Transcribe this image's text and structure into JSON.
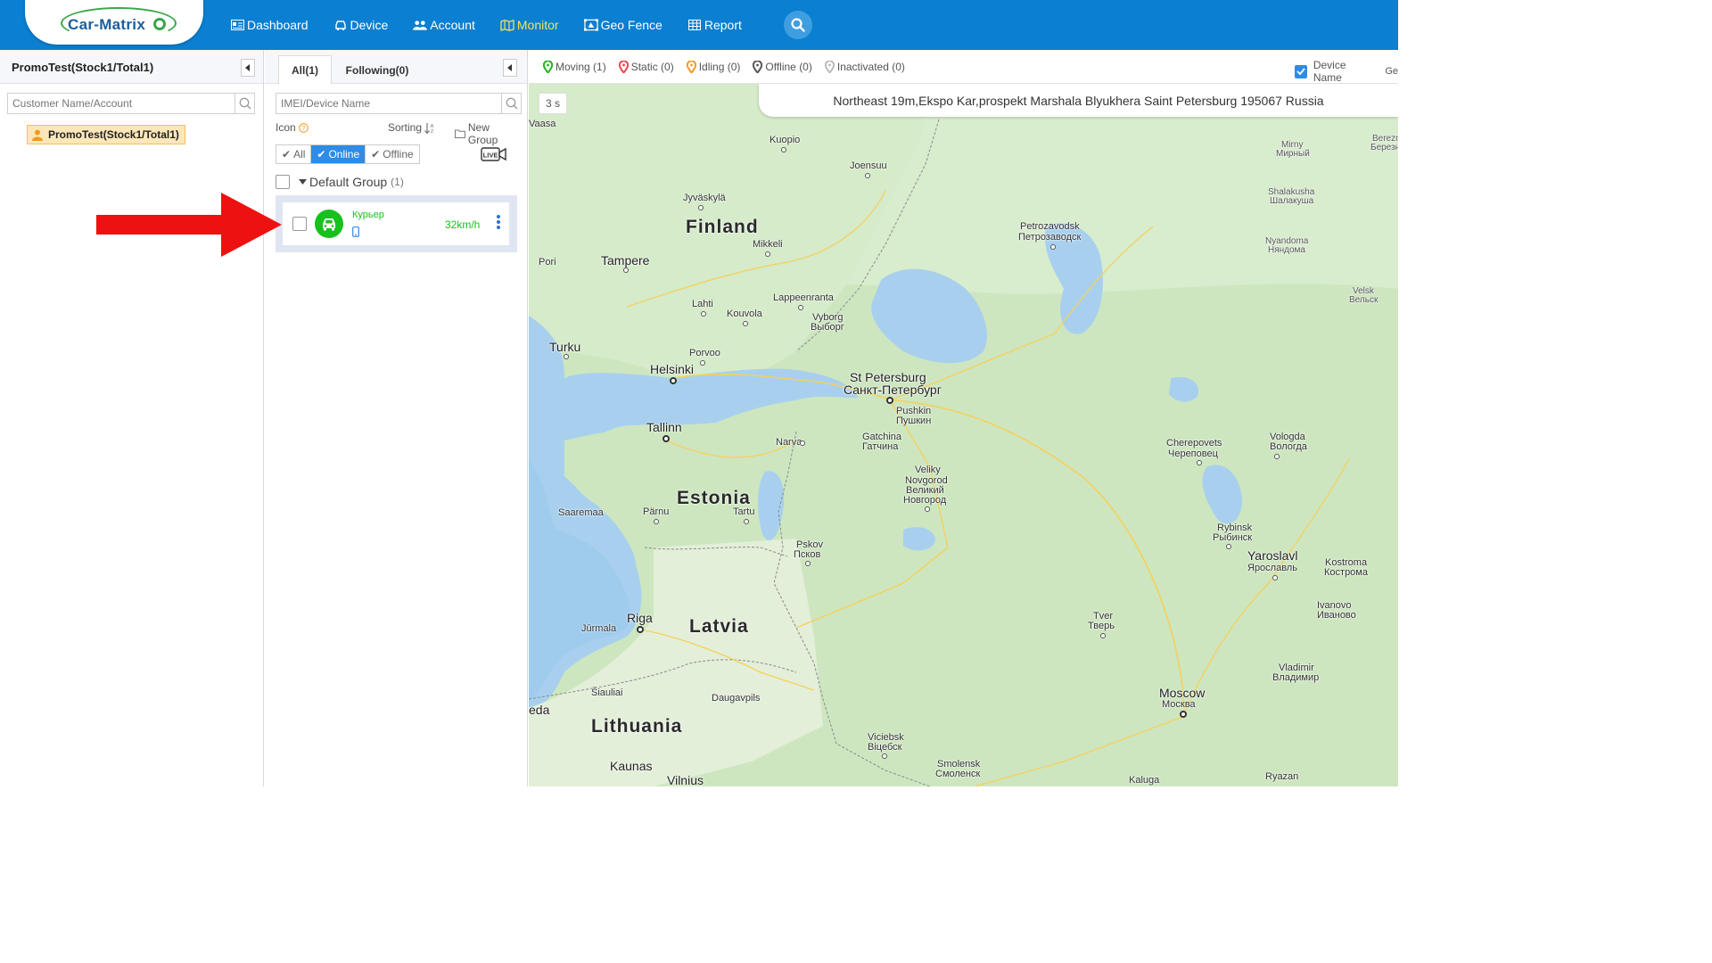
{
  "brand": {
    "name": "Car-Matrix"
  },
  "nav": {
    "items": [
      {
        "label": "Dashboard",
        "icon": "dashboard-icon",
        "active": false
      },
      {
        "label": "Device",
        "icon": "car-icon",
        "active": false
      },
      {
        "label": "Account",
        "icon": "users-icon",
        "active": false
      },
      {
        "label": "Monitor",
        "icon": "map-icon",
        "active": true
      },
      {
        "label": "Geo Fence",
        "icon": "geofence-icon",
        "active": false
      },
      {
        "label": "Report",
        "icon": "table-icon",
        "active": false
      }
    ],
    "search_icon": "search-icon"
  },
  "customer_panel": {
    "title": "PromoTest(Stock1/Total1)",
    "search_placeholder": "Customer Name/Account",
    "selected_customer": "PromoTest(Stock1/Total1)"
  },
  "device_panel": {
    "tabs": [
      {
        "label": "All(1)",
        "active": true
      },
      {
        "label": "Following(0)",
        "active": false
      }
    ],
    "search_placeholder": "IMEI/Device Name",
    "icon_label": "Icon",
    "sorting_label": "Sorting",
    "new_group_label": "New Group",
    "filters": [
      {
        "label": "All",
        "active": false
      },
      {
        "label": "Online",
        "active": true
      },
      {
        "label": "Offline",
        "active": false
      }
    ],
    "live_label": "LIVE",
    "group": {
      "name": "Default Group",
      "count": "(1)"
    },
    "devices": [
      {
        "name": "Курьер",
        "speed": "32km/h",
        "status": "online"
      }
    ]
  },
  "status_bar": {
    "items": [
      {
        "label": "Moving (1)",
        "color": "#1fb51f"
      },
      {
        "label": "Static (0)",
        "color": "#e8474b"
      },
      {
        "label": "Idling (0)",
        "color": "#f39a1c"
      },
      {
        "label": "Offline (0)",
        "color": "#555555"
      },
      {
        "label": "Inactivated (0)",
        "color": "#bbbbbb"
      }
    ],
    "device_name_option": "Device Name",
    "device_name_checked": true
  },
  "map": {
    "address": "Northeast 19m,Ekspo Kar,prospekt Marshala Blyukhera Saint Petersburg 195067 Russia",
    "refresh_timer": "3 s",
    "country_labels": [
      "Finland",
      "Estonia",
      "Latvia",
      "Lithuania"
    ],
    "city_labels": {
      "kuopio": "Kuopio",
      "joensuu": "Joensuu",
      "jyvaskyla": "Jyväskylä",
      "mikkeli": "Mikkeli",
      "tampere": "Tampere",
      "pori": "Pori",
      "lahti": "Lahti",
      "kouvola": "Kouvola",
      "lappeenranta": "Lappeenranta",
      "vyborg": "Vyborg",
      "vyborg_ru": "Выборг",
      "turku": "Turku",
      "porvoo": "Porvoo",
      "helsinki": "Helsinki",
      "stpetersburg": "St Petersburg",
      "stpetersburg_ru": "Санкт-Петербург",
      "pushkin": "Pushkin",
      "pushkin_ru": "Пушкин",
      "gatchina": "Gatchina",
      "gatchina_ru": "Гатчина",
      "tallinn": "Tallinn",
      "narva": "Narva",
      "saaremaa": "Saaremaa",
      "parnu": "Pärnu",
      "tartu": "Tartu",
      "veliky": "Veliky",
      "novgorod": "Novgorod",
      "velikiy_ru": "Великий",
      "novgorod_ru": "Новгород",
      "pskov": "Pskov",
      "pskov_ru": "Псков",
      "petrozavodsk": "Petrozavodsk",
      "petrozavodsk_ru": "Петрозаводск",
      "mirny": "Mirny",
      "mirny_ru": "Мирный",
      "shalakusha": "Shalakusha",
      "shalakusha_ru": "Шалакуша",
      "nyandoma": "Nyandoma",
      "nyandoma_ru": "Няндома",
      "velsk": "Velsk",
      "velsk_ru": "Вельск",
      "bereznik": "Berezn",
      "bereznik_ru": "Березн",
      "cherepovets": "Cherepovets",
      "cherepovets_ru": "Череповец",
      "vologda": "Vologda",
      "vologda_ru": "Вологда",
      "rybinsk": "Rybinsk",
      "rybinsk_ru": "Рыбинск",
      "yaroslavl": "Yaroslavl",
      "yaroslavl_ru": "Ярославль",
      "kostroma": "Kostroma",
      "kostroma_ru": "Кострома",
      "ivanovo": "Ivanovo",
      "ivanovo_ru": "Иваново",
      "tver": "Tver",
      "tver_ru": "Тверь",
      "vladimir": "Vladimir",
      "vladimir_ru": "Владимир",
      "moscow": "Moscow",
      "moscow_ru": "Москва",
      "riga": "Riga",
      "jurmala": "Jūrmala",
      "siauliai": "Šiauliai",
      "daugavpils": "Daugavpils",
      "kaunas": "Kaunas",
      "vilnius": "Vilnius",
      "eda": "eda",
      "vaasa": "Vaasa",
      "viciebsk": "Viciebsk",
      "viciebsk_ru": "Віцебск",
      "smolensk": "Smolensk",
      "smolensk_ru": "Смоленск",
      "kaluga": "Kaluga",
      "ryazan": "Ryazan",
      "ge": "Ge"
    }
  }
}
